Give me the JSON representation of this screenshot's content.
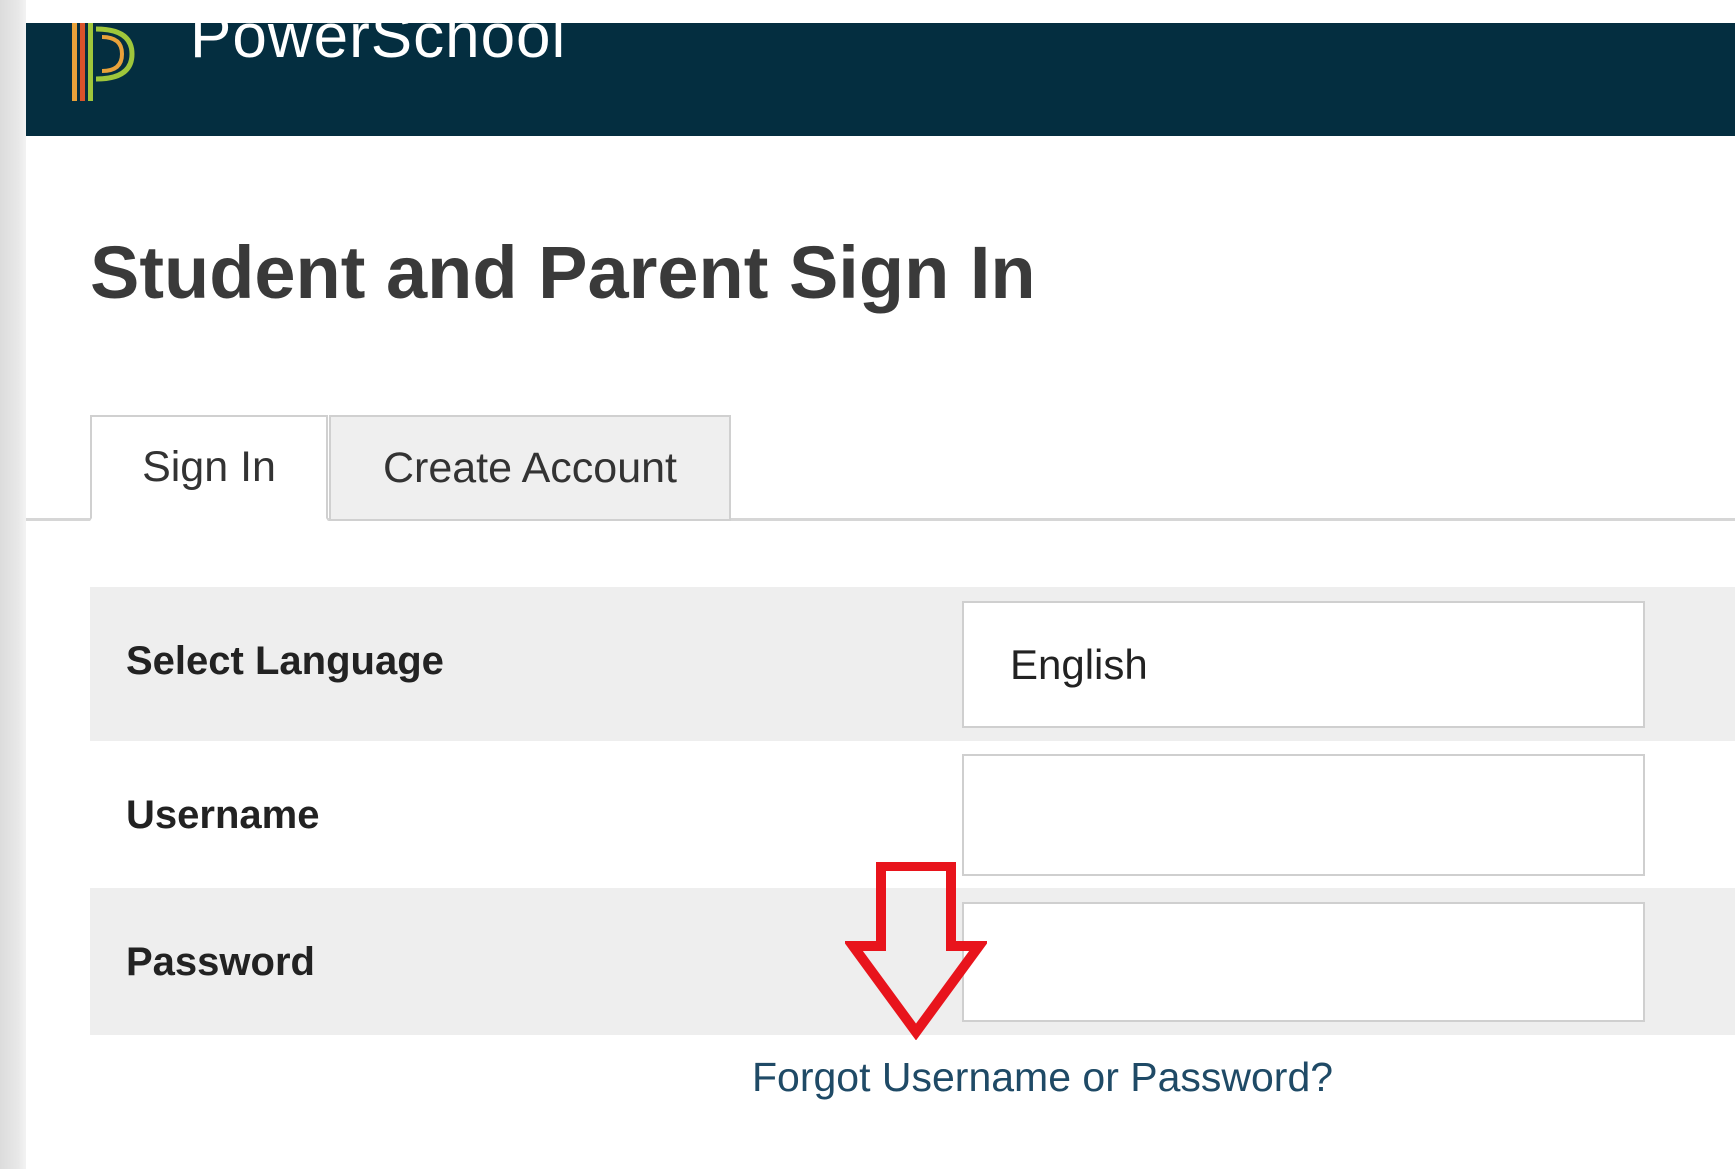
{
  "header": {
    "brand": "PowerSchool",
    "logo_icon": "powerschool-logo-icon",
    "background_color": "#042e40"
  },
  "page": {
    "title": "Student and Parent Sign In"
  },
  "tabs": [
    {
      "label": "Sign In",
      "active": true
    },
    {
      "label": "Create Account",
      "active": false
    }
  ],
  "form": {
    "language": {
      "label": "Select Language",
      "selected": "English"
    },
    "username": {
      "label": "Username",
      "value": ""
    },
    "password": {
      "label": "Password",
      "value": ""
    },
    "forgot_link": "Forgot Username or Password?"
  },
  "annotation": {
    "icon": "red-down-arrow-icon",
    "color": "#e8141c"
  }
}
